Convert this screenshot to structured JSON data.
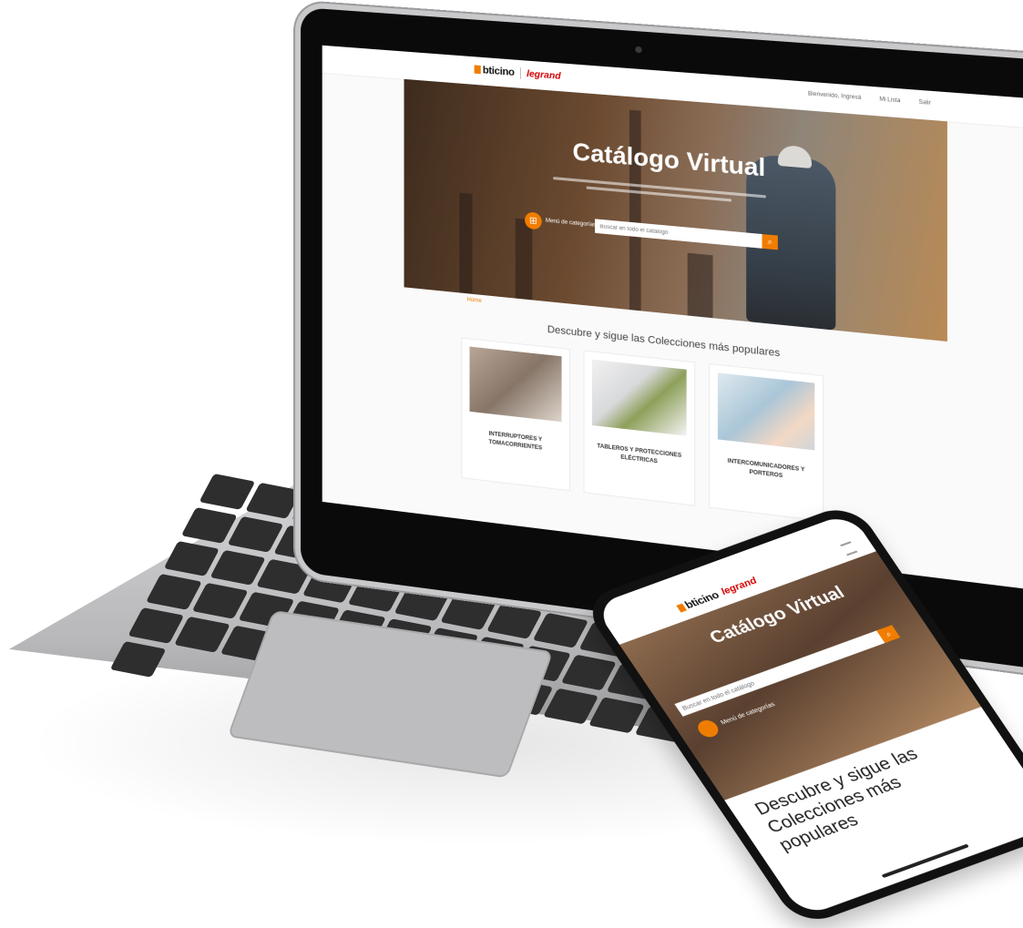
{
  "laptop": {
    "brand": {
      "bticino": "bticino",
      "legrand": "legrand"
    },
    "header_links": [
      "Bienvenido, Ingresá",
      "Mi Lista",
      "Salir"
    ],
    "hero": {
      "title": "Catálogo Virtual",
      "menu_label": "Menú de categorías",
      "search_placeholder": "Buscar en todo el catálogo"
    },
    "breadcrumb": "Home",
    "section_title": "Descubre y sigue las Colecciones más populares",
    "cards": [
      {
        "label": "INTERRUPTORES Y TOMACORRIENTES"
      },
      {
        "label": "TABLEROS Y PROTECCIONES ELÉCTRICAS"
      },
      {
        "label": "INTERCOMUNICADORES Y PORTEROS"
      }
    ]
  },
  "phone": {
    "brand": {
      "bticino": "bticino",
      "legrand": "legrand"
    },
    "hero": {
      "title": "Catálogo Virtual",
      "search_placeholder": "Buscar en todo el catálogo",
      "menu_label": "Menú de categorías"
    },
    "section_title": "Descubre y sigue las Colecciones más populares"
  },
  "icons": {
    "search": "search-icon",
    "menu": "grid-icon",
    "hamburger": "hamburger-icon"
  },
  "colors": {
    "accent": "#f07d00",
    "legrand_red": "#d40000"
  }
}
